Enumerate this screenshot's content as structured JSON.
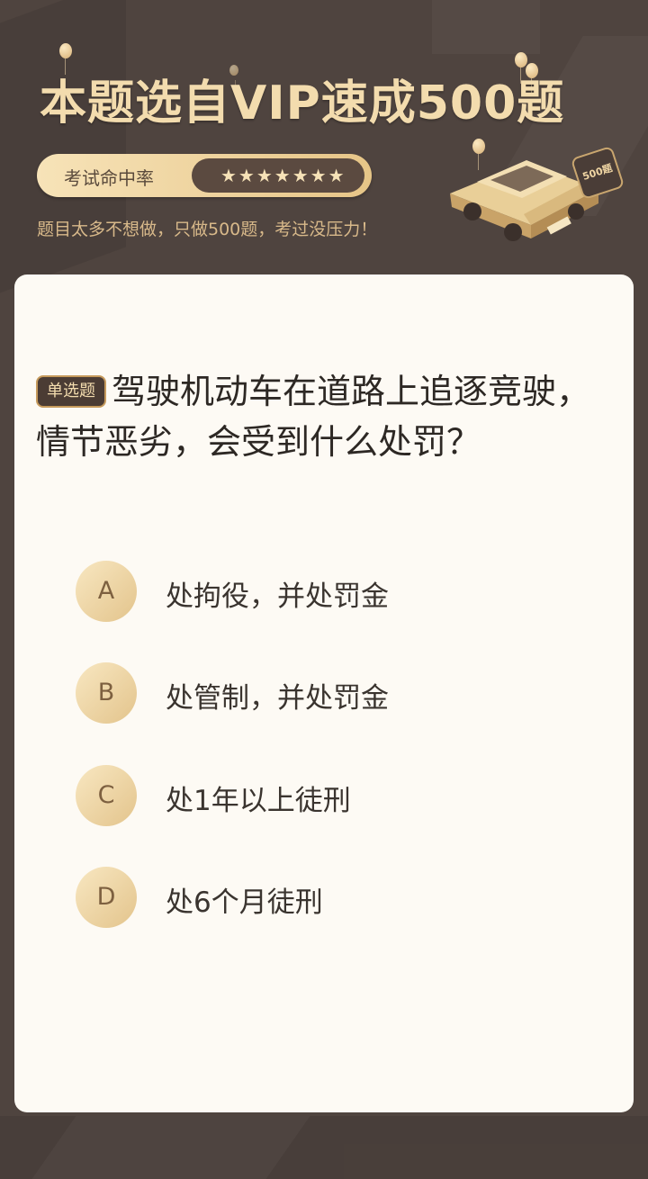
{
  "banner": {
    "headline": "本题选自VIP速成500题",
    "rate_label": "考试命中率",
    "stars": "★★★★★★★",
    "subtext": "题目太多不想做，只做500题，考过没压力！",
    "badge_text": "500题"
  },
  "question": {
    "type_label": "单选题",
    "text": "驾驶机动车在道路上追逐竞驶，情节恶劣，会受到什么处罚？"
  },
  "options": [
    {
      "letter": "A",
      "text": "处拘役，并处罚金"
    },
    {
      "letter": "B",
      "text": "处管制，并处罚金"
    },
    {
      "letter": "C",
      "text": "处1年以上徒刑"
    },
    {
      "letter": "D",
      "text": "处6个月徒刑"
    }
  ],
  "colors": {
    "background": "#4f443f",
    "gold": "#f3dcae",
    "card": "#fdfaf4",
    "option_circle": "#e3c48c"
  }
}
